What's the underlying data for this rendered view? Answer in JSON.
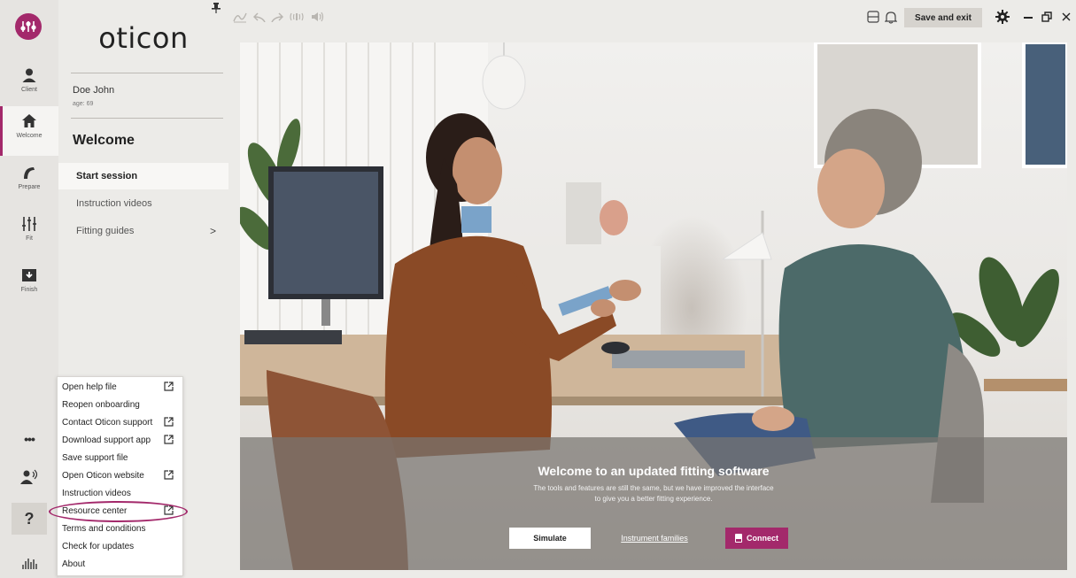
{
  "rail": {
    "items": [
      {
        "label": "Client",
        "icon": "user-icon"
      },
      {
        "label": "Welcome",
        "icon": "home-icon"
      },
      {
        "label": "Prepare",
        "icon": "hearing-aid-icon"
      },
      {
        "label": "Fit",
        "icon": "sliders-icon"
      },
      {
        "label": "Finish",
        "icon": "download-box-icon"
      }
    ],
    "more_label": "•••",
    "help_label": "?"
  },
  "nav": {
    "brand": "oticon",
    "client_name": "Doe John",
    "client_age": "age: 69",
    "title": "Welcome",
    "items": [
      {
        "label": "Start session"
      },
      {
        "label": "Instruction videos"
      },
      {
        "label": "Fitting guides",
        "chevron": ">"
      }
    ]
  },
  "toolbar": {
    "save_exit": "Save and exit"
  },
  "hero": {
    "title": "Welcome to an updated fitting software",
    "subtitle_line1": "The tools and features are still the same, but we have improved the interface",
    "subtitle_line2": "to give you a better fitting experience.",
    "simulate": "Simulate",
    "instrument_families": "Instrument families",
    "connect": "Connect"
  },
  "help_menu": {
    "items": [
      {
        "label": "Open help file",
        "external": true
      },
      {
        "label": "Reopen onboarding",
        "external": false
      },
      {
        "label": "Contact Oticon support",
        "external": true
      },
      {
        "label": "Download support app",
        "external": true
      },
      {
        "label": "Save support file",
        "external": false
      },
      {
        "label": "Open Oticon website",
        "external": true
      },
      {
        "label": "Instruction videos",
        "external": false
      },
      {
        "label": "Resource center",
        "external": true
      },
      {
        "label": "Terms and conditions",
        "external": false
      },
      {
        "label": "Check for updates",
        "external": false
      },
      {
        "label": "About",
        "external": false
      }
    ]
  },
  "colors": {
    "accent": "#a3296b",
    "rail_bg": "#e6e4e1",
    "panel_bg": "#ecebe8"
  }
}
